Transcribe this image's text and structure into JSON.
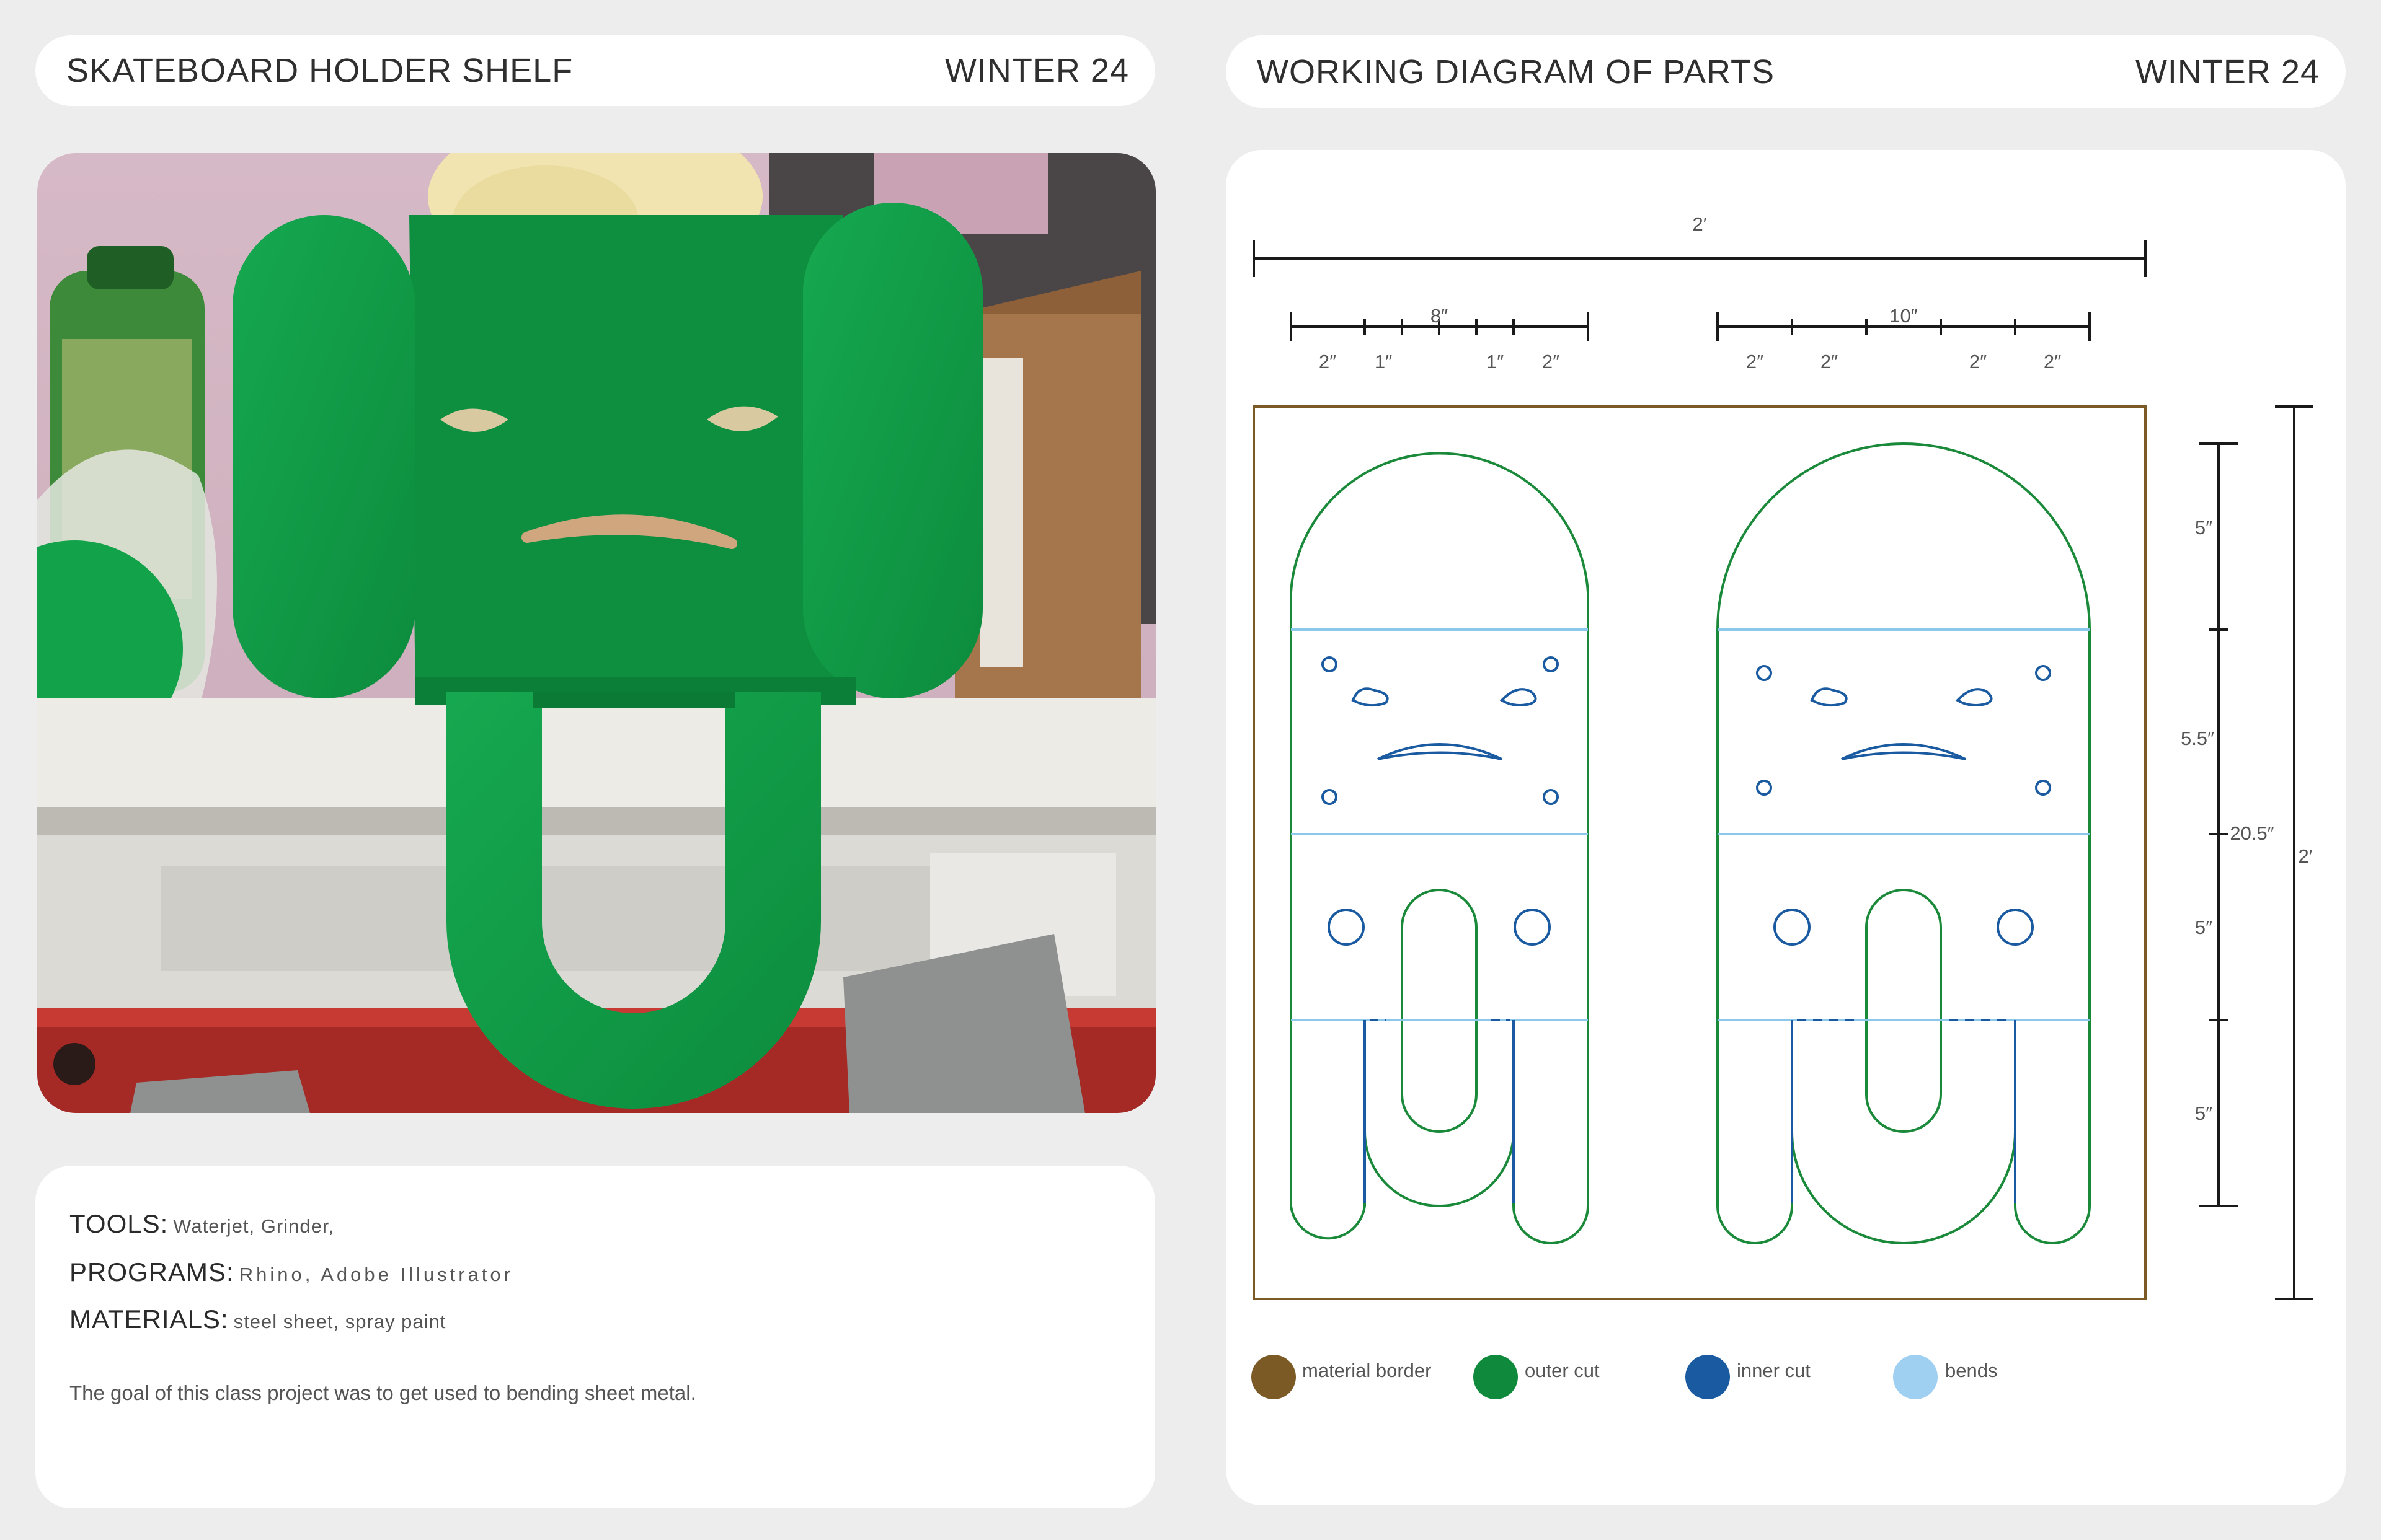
{
  "left_header": {
    "title": "SKATEBOARD HOLDER SHELF",
    "season": "WINTER 24"
  },
  "right_header": {
    "title": "WORKING DIAGRAM OF PARTS",
    "season": "WINTER 24"
  },
  "info": {
    "tools_label": "TOOLS:",
    "tools_value": "Waterjet, Grinder,",
    "programs_label": "PROGRAMS:",
    "programs_value": "Rhino, Adobe Illustrator",
    "materials_label": "MATERIALS:",
    "materials_value": "steel sheet, spray paint",
    "goal": "The goal of this class project was to get used to bending sheet metal."
  },
  "diagram": {
    "dims": {
      "overall_width": "2′",
      "part_a_width": "8″",
      "part_a_segments": [
        "2″",
        "1″",
        "1″",
        "2″"
      ],
      "part_b_width": "10″",
      "part_b_segments": [
        "2″",
        "2″",
        "2″",
        "2″"
      ],
      "vertical_segments": [
        "5″",
        "5.5″",
        "5″",
        "5″"
      ],
      "part_height": "20.5″",
      "overall_height": "2′"
    },
    "legend": [
      {
        "label": "material border",
        "color": "#7b5a26"
      },
      {
        "label": "outer cut",
        "color": "#0f8a3c"
      },
      {
        "label": "inner cut",
        "color": "#1a5aa0"
      },
      {
        "label": "bends",
        "color": "#9fd0f2"
      }
    ]
  },
  "colors": {
    "material_border": "#7b5a26",
    "outer_cut": "#1a8a3a",
    "inner_cut": "#1a5aa0",
    "bends": "#8cc8ea",
    "shelf_green": "#12a24a"
  }
}
